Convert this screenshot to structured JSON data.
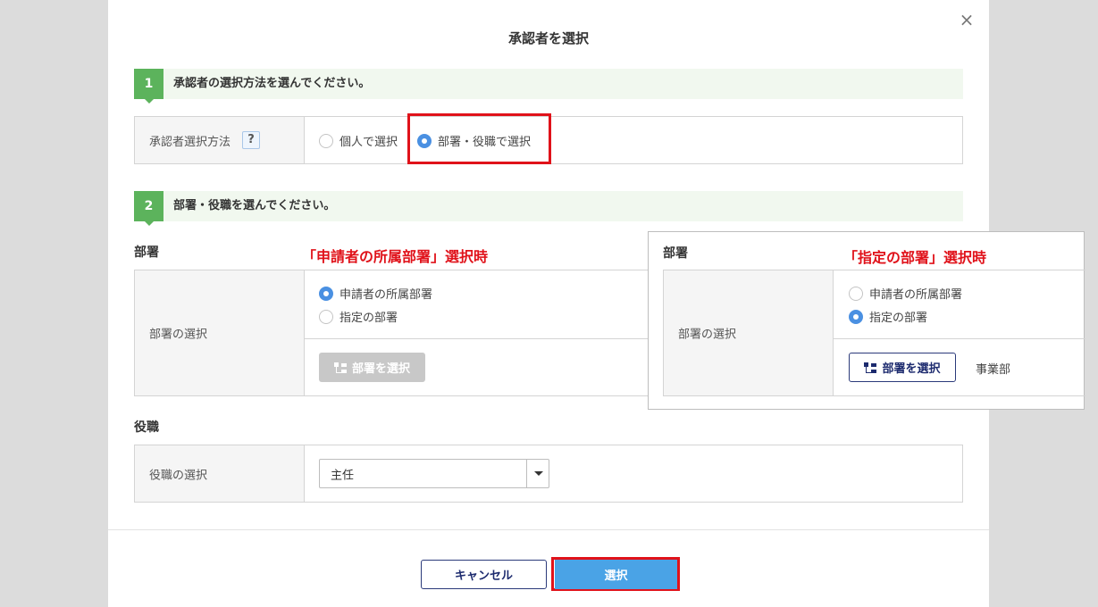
{
  "dialog": {
    "title": "承認者を選択",
    "close_glyph": "×"
  },
  "step1": {
    "number": "1",
    "text": "承認者の選択方法を選んでください。",
    "row_label": "承認者選択方法",
    "help_glyph": "?",
    "options": [
      "個人で選択",
      "部署・役職で選択"
    ],
    "selected": "部署・役職で選択"
  },
  "step2": {
    "number": "2",
    "text": "部署・役職を選んでください。"
  },
  "department": {
    "heading": "部署",
    "note": "「申請者の所属部署」選択時",
    "row_label": "部署の選択",
    "options": [
      "申請者の所属部署",
      "指定の部署"
    ],
    "selected": "申請者の所属部署",
    "button_label": "部署を選択"
  },
  "overlay": {
    "heading": "部署",
    "note": "「指定の部署」選択時",
    "row_label": "部署の選択",
    "options": [
      "申請者の所属部署",
      "指定の部署"
    ],
    "selected": "指定の部署",
    "button_label": "部署を選択",
    "selected_department": "事業部"
  },
  "position": {
    "heading": "役職",
    "row_label": "役職の選択",
    "select_value": "主任"
  },
  "footer": {
    "cancel_label": "キャンセル",
    "ok_label": "選択"
  },
  "colors": {
    "step_green": "#5cb35c",
    "radio_blue": "#4a90e2",
    "highlight_red": "#e0121a",
    "primary_button": "#4aa3e6",
    "navy": "#1c2a6e"
  }
}
